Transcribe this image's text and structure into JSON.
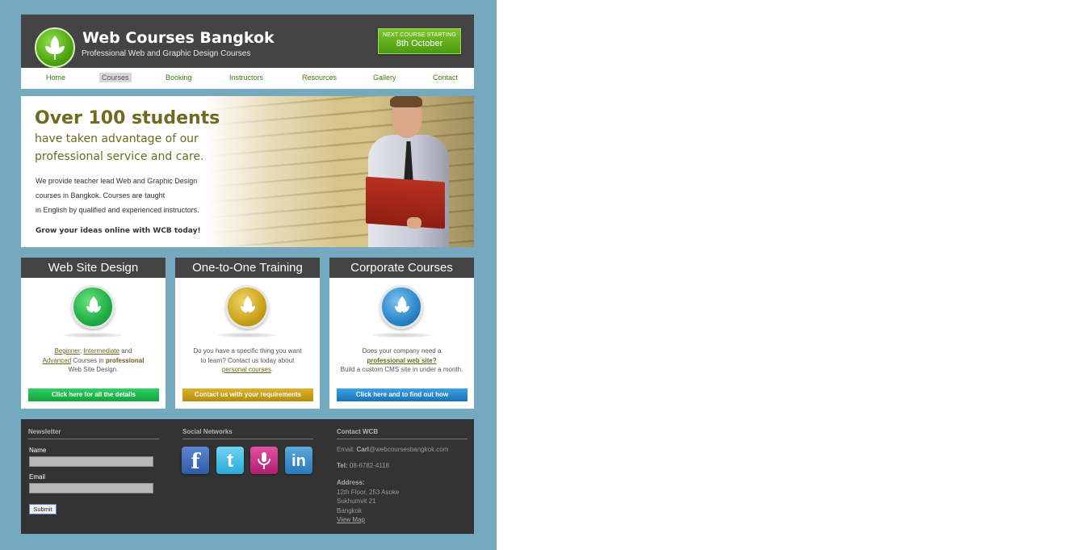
{
  "colors": {
    "page_bg": "#74a9bf",
    "header_bg": "#444444",
    "accent_green": "#3e7b0b",
    "olive_text": "#6e6a20",
    "footer_bg": "#333333"
  },
  "header": {
    "title": "Web Courses Bangkok",
    "subtitle": "Professional Web and Graphic Design Courses",
    "next_course_label": "NEXT COURSE STARTING",
    "next_course_date": "8th October",
    "logo_icon": "leaf-logo-icon"
  },
  "nav": {
    "items": [
      {
        "label": "Home"
      },
      {
        "label": "Courses",
        "active": true
      },
      {
        "label": "Booking"
      },
      {
        "label": "Instructors"
      },
      {
        "label": "Resources"
      },
      {
        "label": "Gallery"
      },
      {
        "label": "Contact"
      }
    ]
  },
  "hero": {
    "headline": "Over 100 students",
    "subline_1": "have taken advantage of our",
    "subline_2": "professional service and care.",
    "para_1": "We provide teacher lead Web and Graphic Design",
    "para_2": "courses in Bangkok. Courses are taught",
    "para_3": "in English by qualified and experienced instructors.",
    "cta": "Grow your ideas online with WCB today!"
  },
  "boxes": [
    {
      "title": "Web Site Design",
      "icon": "green-leaf-badge-icon",
      "color": "#22b34a",
      "link_1": "Beginner",
      "sep_1": ", ",
      "link_2": "Intermediate",
      "text_1": " and",
      "link_3": "Advanced",
      "text_2": " Courses in ",
      "bold": "professional",
      "text_3": "Web Site Design.",
      "button": "Click here for all the details"
    },
    {
      "title": "One-to-One Training",
      "icon": "gold-leaf-badge-icon",
      "color": "#c9a21a",
      "line_1": "Do you have a specific thing you want",
      "line_2": "to learn? Contact us today about",
      "link_1": "personal courses",
      "text_1": ".",
      "button": "Contact us with your requirements"
    },
    {
      "title": "Corporate Courses",
      "icon": "blue-leaf-badge-icon",
      "color": "#2a86c8",
      "line_1": "Does your company need a",
      "link_1": "professional web site?",
      "line_2": "Build a custom CMS site in under a month.",
      "button": "Click here and to find out how"
    }
  ],
  "footer": {
    "newsletter": {
      "title": "Newsletter",
      "name_label": "Name",
      "email_label": "Email",
      "submit": "Submit"
    },
    "social": {
      "title": "Social Networks",
      "icons": [
        "facebook-icon",
        "twitter-icon",
        "podcast-icon",
        "linkedin-icon"
      ]
    },
    "contact": {
      "title": "Contact WCB",
      "email_label": "Email:",
      "email_user": "Carl",
      "email_domain": "@webcoursesbangkok.com",
      "tel_label": "Tel:",
      "tel": "08-6782-4118",
      "address_label": "Address:",
      "address_1": "12th Floor, 253 Asoke",
      "address_2": "Sukhumvit 21",
      "address_3": "Bangkok",
      "map_link": "View Map"
    }
  }
}
